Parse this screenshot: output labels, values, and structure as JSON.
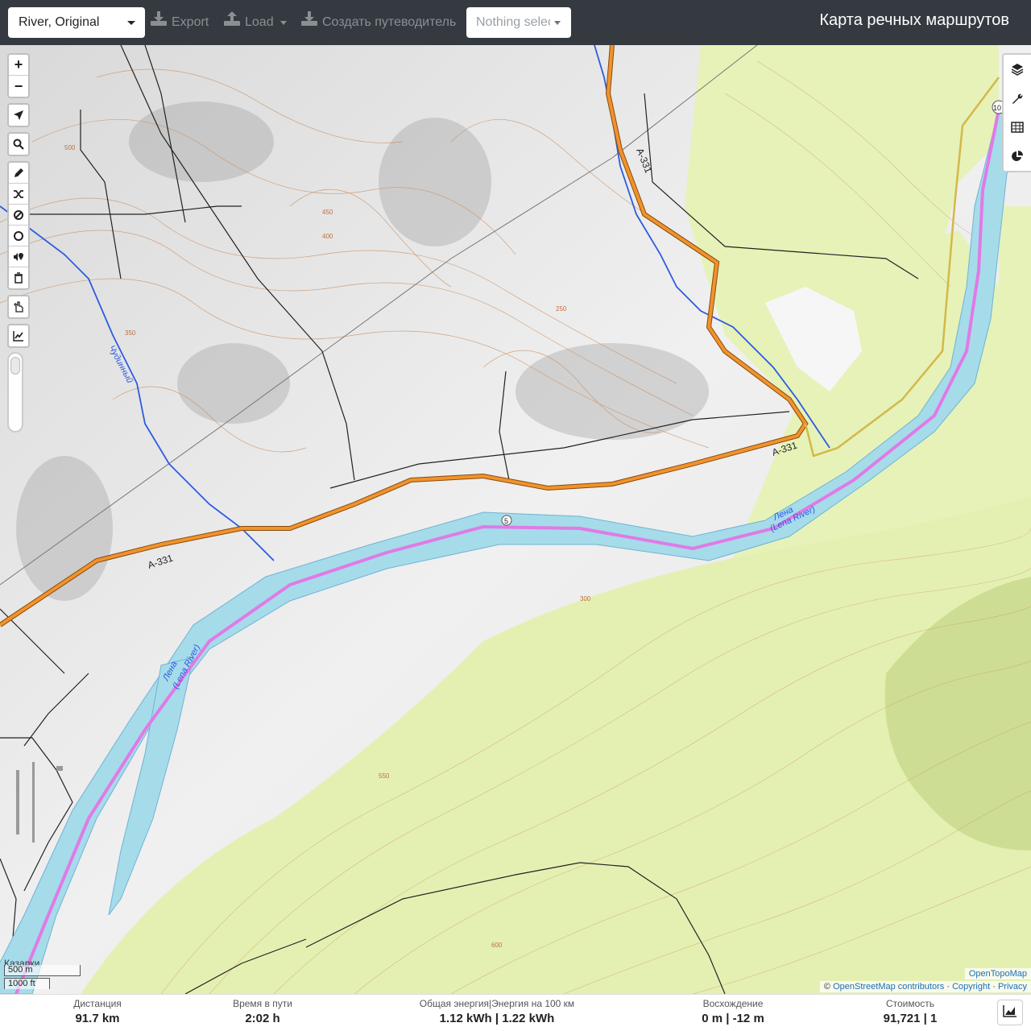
{
  "topbar": {
    "profile_select": "River, Original",
    "export_label": "Export",
    "load_label": "Load",
    "guide_label": "Создать путеводитель",
    "selection_placeholder": "Nothing selected",
    "app_title": "Карта речных маршрутов"
  },
  "map": {
    "zoom_in": "+",
    "zoom_out": "−",
    "labels": {
      "road_a331_1": "A-331",
      "road_a331_2": "A-331",
      "road_a331_3": "A-331",
      "river_name_1": "Лена",
      "river_name_1b": "(Lena River)",
      "river_name_2": "Лена",
      "river_name_2b": "(Lena River)",
      "stream_name": "Чудинный",
      "route_marker": "5",
      "route_marker_2": "10",
      "village": "Казарки"
    },
    "contour_labels": [
      "350",
      "400",
      "450",
      "500",
      "550",
      "600",
      "300",
      "250"
    ],
    "scale_metric": "500 m",
    "scale_imperial": "1000 ft",
    "attribution_tiles": "OpenTopoMap",
    "attribution_prefix": "©",
    "attribution_osm": "OpenStreetMap contributors",
    "attribution_sep1": "·",
    "attribution_copyright": "Copyright",
    "attribution_sep2": "·",
    "attribution_privacy": "Privacy",
    "colors": {
      "river": "#a6dbea",
      "route": "#e07ae6",
      "road": "#f0932b",
      "forest": "#e6f2b8",
      "stream": "#2c5be0"
    }
  },
  "stats": {
    "distance_label": "Дистанция",
    "distance_value": "91.7",
    "distance_unit": "km",
    "time_label": "Время в пути",
    "time_value": "2:02",
    "time_unit": "h",
    "energy_label": "Общая энергия|Энергия на 100 км",
    "energy_value1": "1.12",
    "energy_unit1": "kWh",
    "energy_sep": "|",
    "energy_value2": "1.22",
    "energy_unit2": "kWh",
    "ascent_label": "Восхождение",
    "ascent_value1": "0",
    "ascent_unit1": "m",
    "ascent_sep": "|",
    "ascent_value2": "-12",
    "ascent_unit2": "m",
    "cost_label": "Стоимость",
    "cost_value": "91,721 | 1"
  }
}
